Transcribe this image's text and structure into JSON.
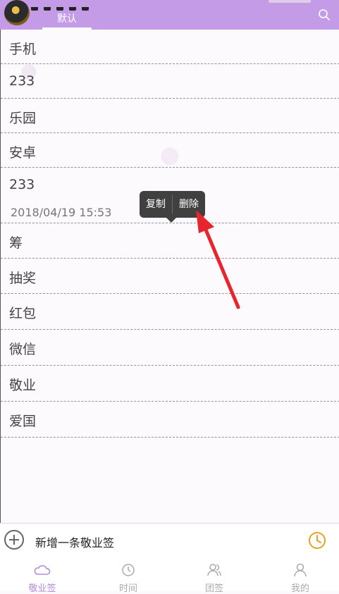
{
  "header": {
    "tab_label": "默认"
  },
  "list": {
    "items": [
      {
        "text": "手机"
      },
      {
        "text": "233"
      },
      {
        "text": "乐园"
      },
      {
        "text": "安卓"
      },
      {
        "text": "233",
        "timestamp": "2018/04/19 15:53"
      },
      {
        "text": "筹"
      },
      {
        "text": "抽奖"
      },
      {
        "text": "红包"
      },
      {
        "text": "微信"
      },
      {
        "text": "敬业"
      },
      {
        "text": "爱国"
      }
    ]
  },
  "popup": {
    "copy_label": "复制",
    "delete_label": "删除"
  },
  "add_bar": {
    "text": "新增一条敬业签"
  },
  "bottom_nav": {
    "items": [
      {
        "label": "敬业签",
        "active": true
      },
      {
        "label": "时间"
      },
      {
        "label": "团签"
      },
      {
        "label": "我的"
      }
    ]
  },
  "colors": {
    "header_bg": "#c39be6",
    "accent": "#b58be0",
    "clock_orange": "#e8a020",
    "arrow_red": "#e8252c",
    "popup_bg": "#404040"
  }
}
